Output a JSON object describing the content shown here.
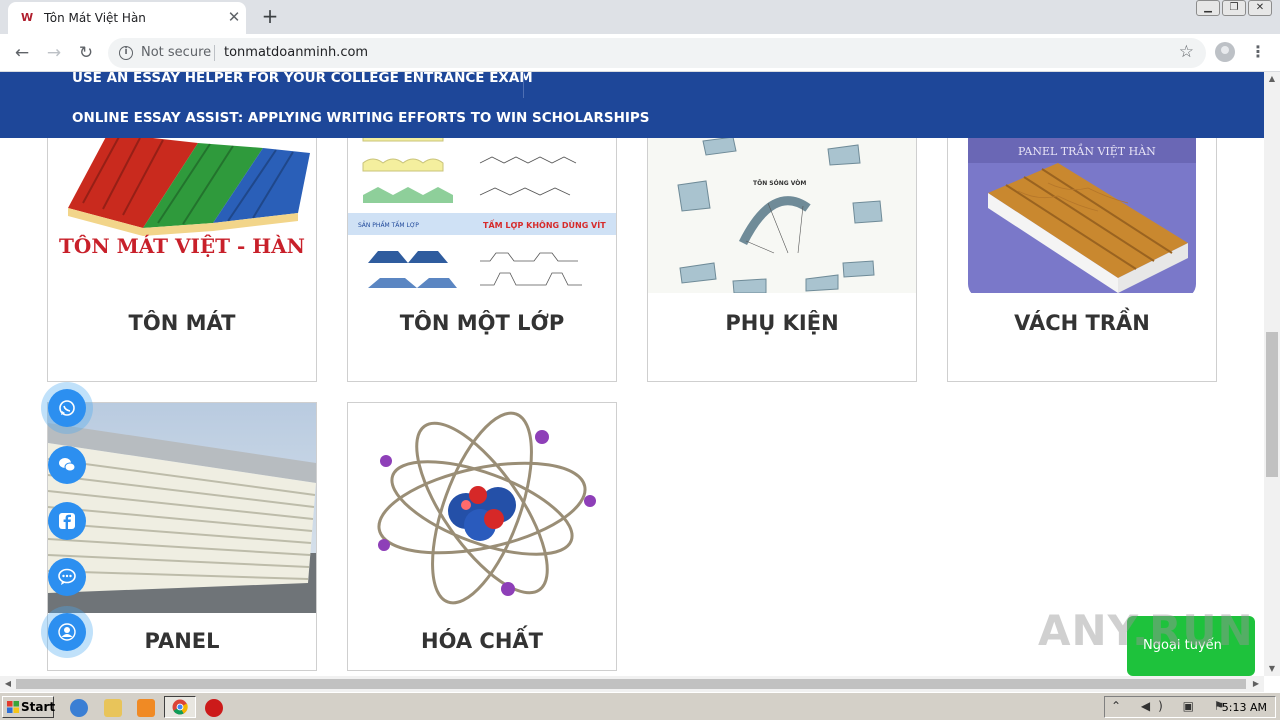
{
  "browser": {
    "tab_title": "Tôn Mát Việt Hàn",
    "tab_favicon": "W",
    "close_glyph": "✕",
    "new_tab_glyph": "+",
    "back_glyph": "←",
    "forward_glyph": "→",
    "reload_glyph": "↻",
    "security_label": "Not secure",
    "url": "tonmatdoanminh.com",
    "star_glyph": "☆",
    "menu_glyph": "⋮",
    "win_minimize": "▁",
    "win_restore": "❐",
    "win_close": "✕"
  },
  "navbar": {
    "links": [
      "USE AN ESSAY HELPER FOR YOUR COLLEGE ENTRANCE EXAM",
      "ONLINE ESSAY ASSIST: APPLYING WRITING EFFORTS TO WIN SCHOLARSHIPS"
    ]
  },
  "products": [
    {
      "title": "TÔN MÁT",
      "image_text": "TÔN MÁT VIỆT - HÀN"
    },
    {
      "title": "TÔN MỘT LỚP",
      "image_text": "TẤM LỢP KHÔNG DÙNG VÍT"
    },
    {
      "title": "PHỤ KIỆN",
      "image_text": "TÔN SÓNG VÒM"
    },
    {
      "title": "VÁCH TRẦN",
      "image_text": "PANEL TRẦN VIỆT HÀN"
    },
    {
      "title": "PANEL"
    },
    {
      "title": "HÓA CHẤT"
    }
  ],
  "social": {
    "icons": [
      "whatsapp-icon",
      "wechat-icon",
      "facebook-icon",
      "messenger-icon",
      "user-support-icon"
    ],
    "accent_color": "#2c8ff0"
  },
  "chat": {
    "label": "Ngoại tuyến",
    "color": "#1ec23c"
  },
  "watermark": "ANY.RUN",
  "taskbar": {
    "start_label": "Start",
    "clock": "5:13 AM",
    "tray_glyphs": "⌃ ◀) ▣ ⚑"
  },
  "colors": {
    "navbar": "#1e4799",
    "title_text": "#333333"
  }
}
